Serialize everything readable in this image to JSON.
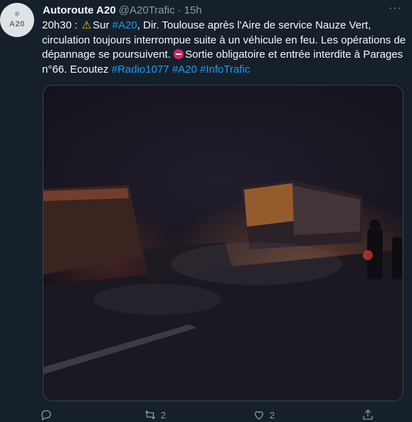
{
  "author": {
    "avatar_text": "A20",
    "name": "Autoroute A20",
    "handle": "@A20Trafic",
    "separator": "·",
    "time": "15h"
  },
  "tweet": {
    "p1": "20h30 : ",
    "p2": "Sur ",
    "h1": "#A20",
    "p3": ", Dir. Toulouse après l'Aire de service Nauze Vert, circulation toujours interrompue suite à un véhicule en feu. Les opérations de dépannage se poursuivent. ",
    "p4": "Sortie obligatoire et entrée interdite à Parages n°66. Ecoutez ",
    "h2": "#Radio1077",
    "h3": "#A20",
    "h4": "#InfoTrafic"
  },
  "icons": {
    "warning": "warning-icon",
    "no_entry": "no-entry-icon"
  },
  "colors": {
    "background": "#15202b",
    "link": "#1d9bf0",
    "muted": "#8b98a5"
  },
  "actions": {
    "reply_count": "",
    "retweet_count": "2",
    "like_count": "2"
  }
}
